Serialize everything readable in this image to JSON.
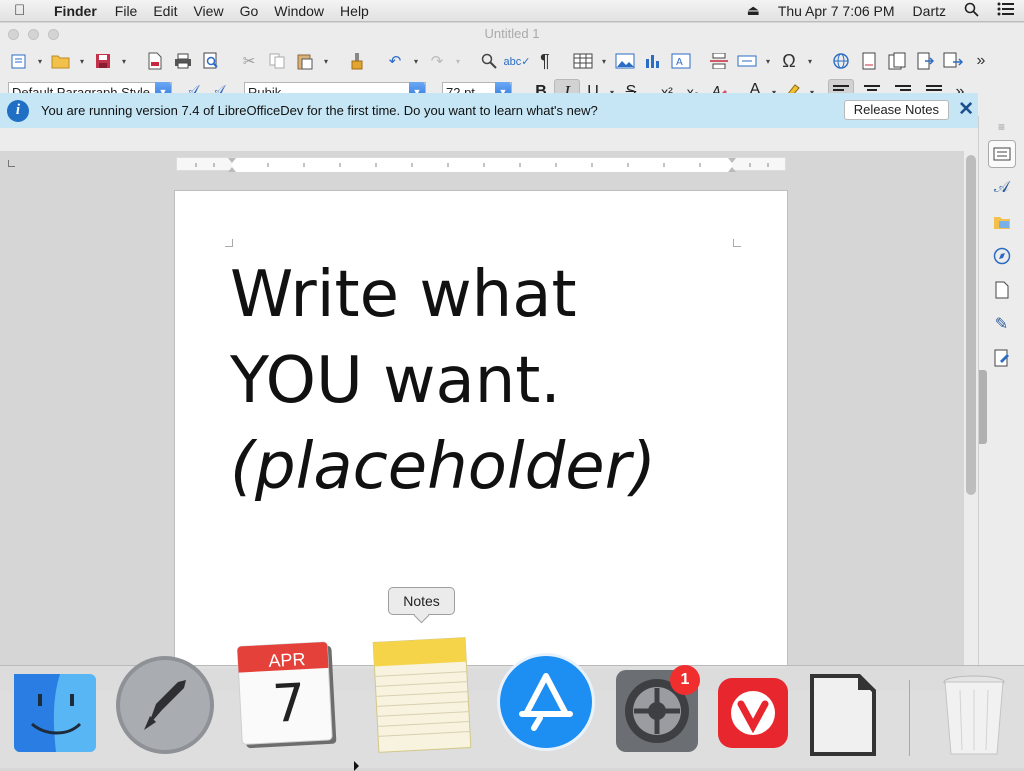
{
  "menubar": {
    "app_name": "Finder",
    "items": [
      "File",
      "Edit",
      "View",
      "Go",
      "Window",
      "Help"
    ],
    "clock": "Thu Apr 7  7:06 PM",
    "user": "Dartz"
  },
  "window": {
    "title": "Untitled 1"
  },
  "formatting": {
    "paragraph_style": "Default Paragraph Style",
    "font_name": "Rubik",
    "font_size": "72 pt",
    "bold": "B",
    "italic": "I",
    "underline": "U",
    "strike": "S",
    "superscript": "x²",
    "subscript": "x₂",
    "font_color_glyph": "A",
    "italic_active": true
  },
  "infobar": {
    "message": "You are running version 7.4 of LibreOfficeDev for the first time. Do you want to learn what's new?",
    "button": "Release Notes"
  },
  "document": {
    "lines": [
      "Write what",
      "YOU want.",
      "(placeholder)"
    ]
  },
  "dock": {
    "tooltip": "Notes",
    "calendar_month": "APR",
    "calendar_day": "7",
    "system_prefs_badge": "1"
  }
}
